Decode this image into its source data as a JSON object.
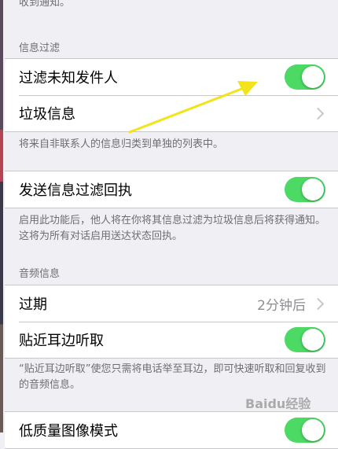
{
  "top_note": "收到通知。",
  "filter_section": {
    "header": "信息过滤",
    "filter_unknown_label": "过滤未知发件人",
    "junk_label": "垃圾信息",
    "footer": "将来自非联系人的信息归类到单独的列表中。"
  },
  "receipt_section": {
    "label": "发送信息过滤回执",
    "footer": "启用此功能后，他人将在你将其信息过滤为垃圾信息后将获得通知。这将为所有对话启用送达状态回执。"
  },
  "audio_section": {
    "header": "音频信息",
    "expire_label": "过期",
    "expire_value": "2分钟后",
    "raise_label": "贴近耳边听取",
    "footer": "“贴近耳边听取”使您只需将电话举至耳边，即可快速听取和回复收到的音频信息。"
  },
  "low_quality_label": "低质量图像模式",
  "watermark": "Baidu经验",
  "toggles": {
    "filter_unknown": true,
    "filter_receipt": true,
    "raise_to_listen": true,
    "low_quality": true
  },
  "colors": {
    "toggle_on": "#4cd964",
    "annotation_arrow": "#f2e31a"
  }
}
